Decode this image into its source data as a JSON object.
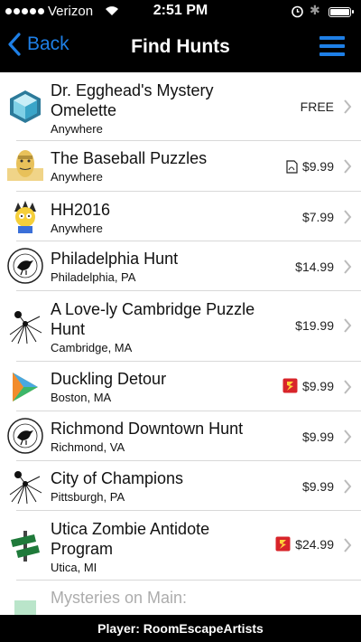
{
  "status_bar": {
    "carrier": "Verizon",
    "time": "2:51 PM",
    "battery_level": 0.9
  },
  "nav": {
    "back_label": "Back",
    "title": "Find Hunts",
    "menu_icon": "hamburger-menu-icon"
  },
  "colors": {
    "accent": "#1e7fe6",
    "bar": "#000000"
  },
  "hunts": [
    {
      "title": "Dr. Egghead's Mystery Omelette",
      "location": "Anywhere",
      "price": "FREE",
      "icon": "cube-icon"
    },
    {
      "title": "The Baseball Puzzles",
      "location": "Anywhere",
      "price": "$9.99",
      "icon": "baseball-character-icon",
      "badge": "pdf-icon"
    },
    {
      "title": "HH2016",
      "location": "Anywhere",
      "price": "$7.99",
      "icon": "cartoon-character-icon"
    },
    {
      "title": "Philadelphia Hunt",
      "location": "Philadelphia, PA",
      "price": "$14.99",
      "icon": "raven-logo-icon"
    },
    {
      "title": "A Love-ly Cambridge Puzzle Hunt",
      "location": "Cambridge, MA",
      "price": "$19.99",
      "icon": "spider-icon"
    },
    {
      "title": "Duckling Detour",
      "location": "Boston, MA",
      "price": "$9.99",
      "icon": "duckling-detour-logo-icon",
      "badge": "episode-icon"
    },
    {
      "title": "Richmond Downtown Hunt",
      "location": "Richmond, VA",
      "price": "$9.99",
      "icon": "raven-logo-icon"
    },
    {
      "title": "City of Champions",
      "location": "Pittsburgh, PA",
      "price": "$9.99",
      "icon": "spider-icon"
    },
    {
      "title": "Utica Zombie Antidote Program",
      "location": "Utica, MI",
      "price": "$24.99",
      "icon": "street-sign-icon",
      "badge": "episode-icon"
    },
    {
      "title": "Mysteries on Main:",
      "location": "",
      "price": "",
      "icon": "partial-icon"
    }
  ],
  "footer": {
    "text": "Player: RoomEscapeArtists"
  }
}
